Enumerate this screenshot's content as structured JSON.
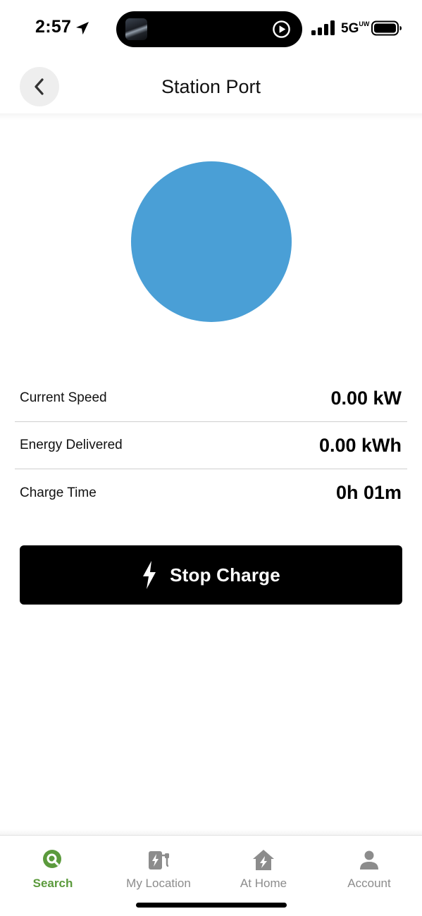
{
  "status_bar": {
    "time": "2:57",
    "network": "5G",
    "network_badge": "UW"
  },
  "header": {
    "title": "Station Port"
  },
  "status_circle": {
    "color": "#4a9fd6"
  },
  "stats": [
    {
      "label": "Current Speed",
      "value": "0.00 kW"
    },
    {
      "label": "Energy Delivered",
      "value": "0.00 kWh"
    },
    {
      "label": "Charge Time",
      "value": "0h 01m"
    }
  ],
  "stop_button": {
    "label": "Stop Charge",
    "icon": "lightning-bolt-icon"
  },
  "tabs": [
    {
      "label": "Search",
      "icon": "search-icon",
      "active": true
    },
    {
      "label": "My Location",
      "icon": "charging-station-icon",
      "active": false
    },
    {
      "label": "At Home",
      "icon": "home-charging-icon",
      "active": false
    },
    {
      "label": "Account",
      "icon": "person-icon",
      "active": false
    }
  ],
  "colors": {
    "accent": "#5b9a3c",
    "inactive_tab": "#8c8c8c",
    "button_bg": "#000000"
  }
}
